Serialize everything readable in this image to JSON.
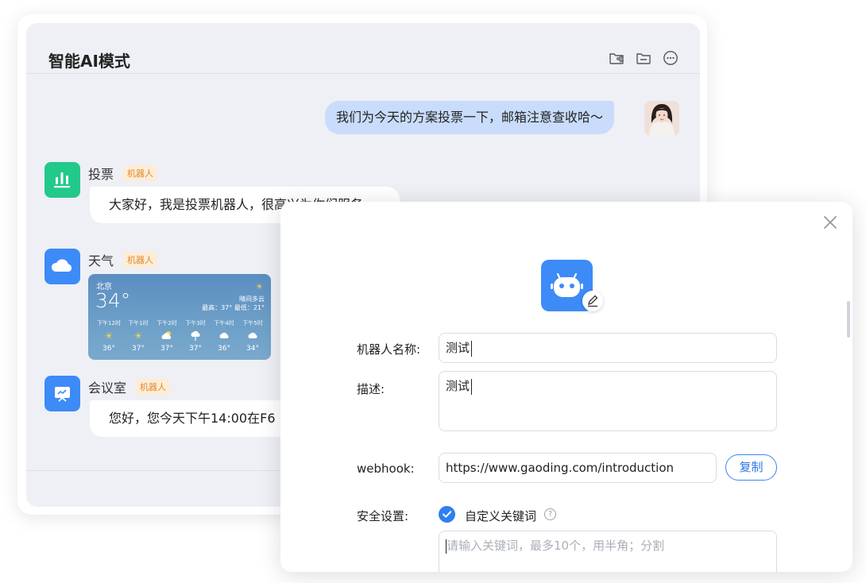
{
  "chat": {
    "title": "智能AI模式",
    "header_icons": [
      "folder-share-icon",
      "folder-icon",
      "more-options-icon"
    ],
    "my_message": "我们为今天的方案投票一下，邮箱注意查收哈～",
    "bot_tag": "机器人",
    "bots": [
      {
        "name": "投票",
        "icon": "bar-chart-icon",
        "color": "#22c98b",
        "message": "大家好，我是投票机器人，很高兴为你们服务"
      },
      {
        "name": "天气",
        "icon": "cloud-icon",
        "color": "#3d8bf7"
      },
      {
        "name": "会议室",
        "icon": "presentation-icon",
        "color": "#3d8bf7",
        "message": "您好，您今天下午14:00在F6"
      }
    ],
    "weather": {
      "city": "北京",
      "temp": "34°",
      "desc": "晴间多云",
      "range": "最高：37° 最低：21°",
      "hours": [
        {
          "time": "下午12时",
          "icon": "sun-icon",
          "temp": "36°"
        },
        {
          "time": "下午1时",
          "icon": "sun-icon",
          "temp": "37°"
        },
        {
          "time": "下午2时",
          "icon": "partly-cloudy-icon",
          "temp": "37°"
        },
        {
          "time": "下午3时",
          "icon": "rain-cloud-icon",
          "temp": "37°"
        },
        {
          "time": "下午4时",
          "icon": "cloud-icon",
          "temp": "36°"
        },
        {
          "time": "下午5时",
          "icon": "cloud-icon",
          "temp": "34°"
        }
      ]
    }
  },
  "dialog": {
    "name_label": "机器人名称:",
    "name_value": "测试",
    "desc_label": "描述:",
    "desc_value": "测试",
    "webhook_label": "webhook:",
    "webhook_value": "https://www.gaoding.com/introduction",
    "copy_label": "复制",
    "security_label": "安全设置:",
    "keyword_option": "自定义关键词",
    "keyword_checked": true,
    "keyword_placeholder": "请输入关键词，最多10个，用半角；分割",
    "help_glyph": "?",
    "accent_color": "#2f7ff0"
  }
}
